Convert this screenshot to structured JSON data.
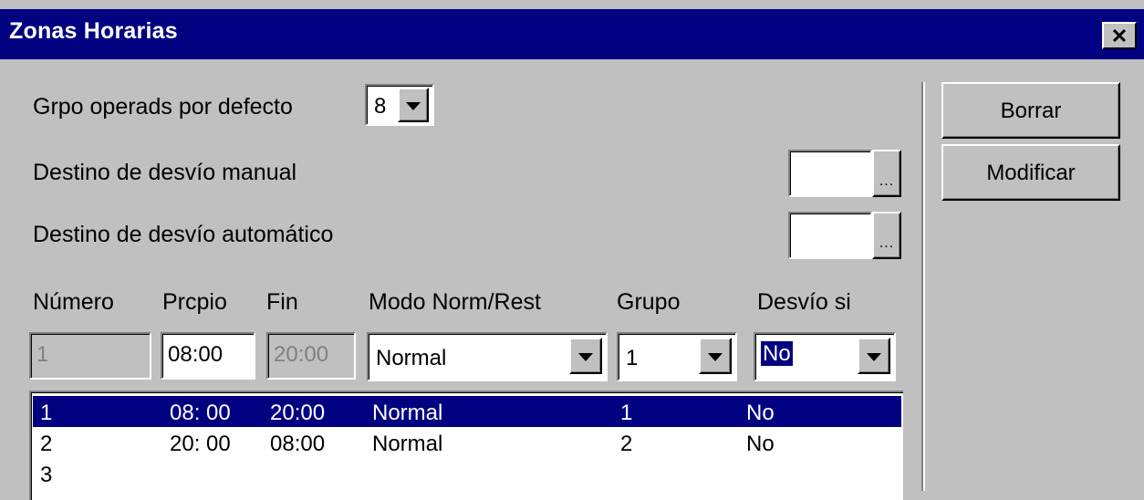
{
  "window": {
    "title": "Zonas Horarias"
  },
  "fields": {
    "grupo_defecto_label": "Grpo operads por defecto",
    "grupo_defecto_value": "8",
    "desvio_manual_label": "Destino de desvío manual",
    "desvio_auto_label": "Destino de desvío automático",
    "browse_label": "..."
  },
  "buttons": {
    "borrar": "Borrar",
    "modificar": "Modificar"
  },
  "columns": {
    "numero": "Número",
    "principio": "Prcpio",
    "fin": "Fin",
    "modo": "Modo Norm/Rest",
    "grupo": "Grupo",
    "desvio": "Desvío si"
  },
  "editor": {
    "numero": "1",
    "principio": "08:00",
    "fin": "20:00",
    "modo": "Normal",
    "grupo": "1",
    "desvio": "No"
  },
  "rows": [
    {
      "numero": "1",
      "principio": "08: 00",
      "fin": "20:00",
      "modo": "Normal",
      "grupo": "1",
      "desvio": "No",
      "selected": true
    },
    {
      "numero": "2",
      "principio": "20: 00",
      "fin": "08:00",
      "modo": "Normal",
      "grupo": "2",
      "desvio": "No",
      "selected": false
    },
    {
      "numero": "3",
      "principio": "",
      "fin": "",
      "modo": "",
      "grupo": "",
      "desvio": "",
      "selected": false
    }
  ],
  "colors": {
    "titlebar": "#000080",
    "face": "#c0c0c0",
    "highlight": "#000080"
  }
}
